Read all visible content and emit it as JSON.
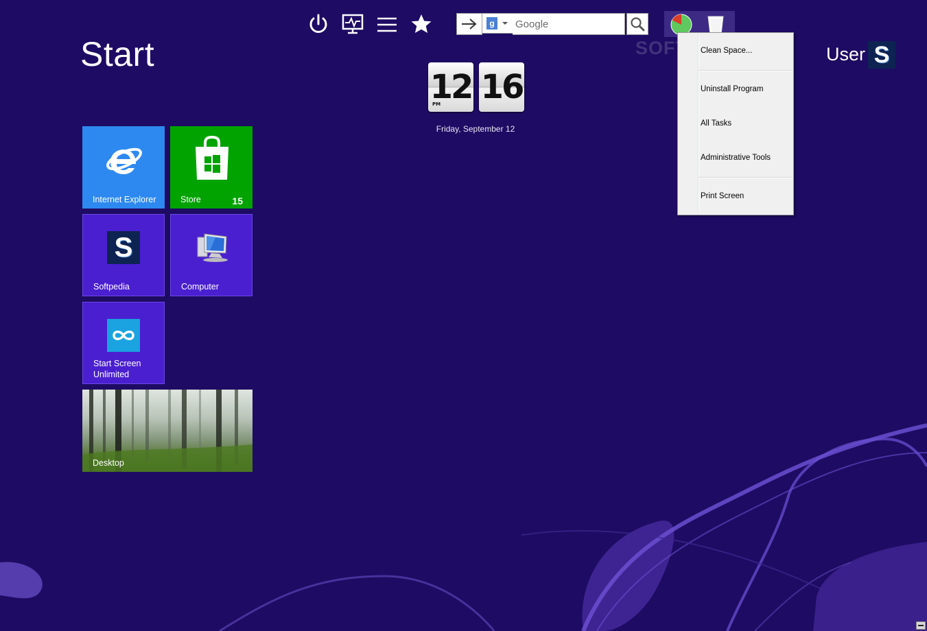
{
  "page": {
    "title": "Start"
  },
  "toolbar": {
    "buttons": [
      {
        "name": "power-button",
        "icon": "power-icon"
      },
      {
        "name": "monitor-button",
        "icon": "monitor-pulse-icon"
      },
      {
        "name": "menu-button",
        "icon": "hamburger-icon"
      },
      {
        "name": "favorites-button",
        "icon": "star-icon"
      }
    ]
  },
  "search": {
    "engine": "g",
    "placeholder": "Google",
    "value": ""
  },
  "watermark": "SOFTPEDIA",
  "context_menu": {
    "items": [
      {
        "label": "Clean Space..."
      },
      {
        "label": "Uninstall Program"
      },
      {
        "label": "All Tasks"
      },
      {
        "label": "Administrative Tools"
      },
      {
        "label": "Print Screen"
      }
    ]
  },
  "user": {
    "name": "User",
    "avatar_letter": "S"
  },
  "clock": {
    "hour": "12",
    "minute": "16",
    "meridiem": "PM",
    "date": "Friday, September 12"
  },
  "tiles": [
    {
      "label": "Internet Explorer",
      "color": "#2d89ef",
      "icon": "internet-explorer-icon"
    },
    {
      "label": "Store",
      "color": "#00a300",
      "icon": "store-bag-icon",
      "badge": "15"
    },
    {
      "label": "Softpedia",
      "color": "#4a1fd0",
      "icon": "softpedia-logo-icon"
    },
    {
      "label": "Computer",
      "color": "#4a1fd0",
      "icon": "computer-icon"
    },
    {
      "label": "Start Screen\nUnlimited",
      "color": "#4a1fd0",
      "icon": "infinity-icon"
    },
    {
      "label": "Desktop",
      "icon": "forest-wallpaper"
    }
  ],
  "colors": {
    "background": "#1e0b63",
    "tile_purple": "#4a1fd0",
    "menu_bg": "#f0f0f0"
  }
}
